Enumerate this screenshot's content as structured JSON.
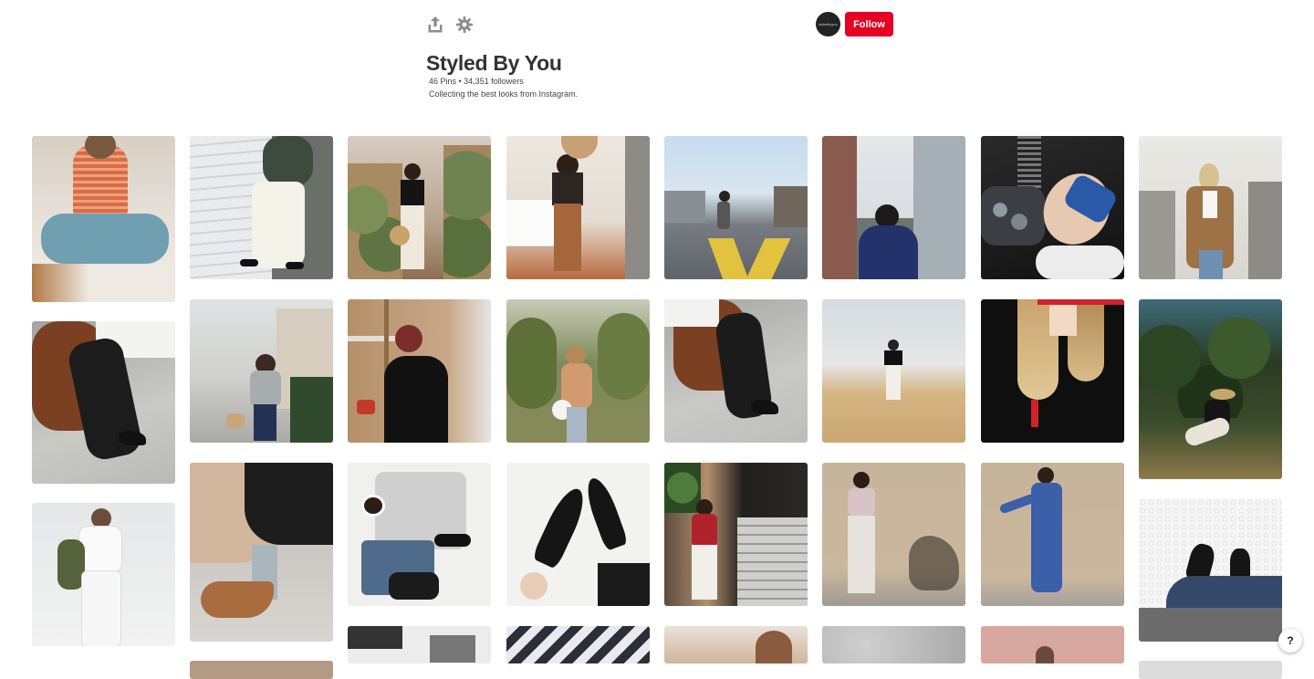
{
  "header": {
    "share_icon": "share-upload-icon",
    "settings_icon": "gear-icon",
    "avatar_text": "StyledByYou",
    "follow_label": "Follow",
    "accent_color": "#e60023"
  },
  "board": {
    "title": "Styled By You",
    "stats": "46 Pins • 34,351 followers",
    "description": "Collecting the best looks from Instagram."
  },
  "help": {
    "label": "?"
  },
  "pins": [
    {
      "col": 0,
      "scene": "woman in orange striped tee sitting on bed with mug"
    },
    {
      "col": 0,
      "scene": "legs in black pants and loafers on chair"
    },
    {
      "col": 0,
      "scene": "woman in white jeans holding jacket"
    },
    {
      "col": 1,
      "scene": "woman in white wide-leg pants on stairs"
    },
    {
      "col": 1,
      "scene": "person walking dog on sidewalk"
    },
    {
      "col": 1,
      "scene": "hand adjusting brown loafer"
    },
    {
      "col": 1,
      "scene": "partial bottom pin"
    },
    {
      "col": 2,
      "scene": "woman among potted cacti with straw hat"
    },
    {
      "col": 2,
      "scene": "woman with red hair in black sweater with tea"
    },
    {
      "col": 2,
      "scene": "flat lay of grey shirt, jeans and sneakers"
    },
    {
      "col": 2,
      "scene": "laptop flat lay"
    },
    {
      "col": 3,
      "scene": "woman in brown trousers in bedroom mirror"
    },
    {
      "col": 3,
      "scene": "woman in orchard with white bag"
    },
    {
      "col": 3,
      "scene": "pointed black flats on white rug"
    },
    {
      "col": 3,
      "scene": "striped stripes partial"
    },
    {
      "col": 4,
      "scene": "woman standing on street crosswalk"
    },
    {
      "col": 4,
      "scene": "legs in black pants and loafers"
    },
    {
      "col": 4,
      "scene": "woman in red top and white pants by steps"
    },
    {
      "col": 4,
      "scene": "man portrait partial"
    },
    {
      "col": 5,
      "scene": "woman between city buildings"
    },
    {
      "col": 5,
      "scene": "woman in golden field"
    },
    {
      "col": 5,
      "scene": "woman in grey pants on beige wall"
    },
    {
      "col": 5,
      "scene": "grey texture partial"
    },
    {
      "col": 6,
      "scene": "foot in blue sandal with sequin clutch"
    },
    {
      "col": 6,
      "scene": "woman in black sweater with necklace"
    },
    {
      "col": 6,
      "scene": "woman in blue denim jumpsuit"
    },
    {
      "col": 6,
      "scene": "pink wall partial"
    },
    {
      "col": 7,
      "scene": "woman in tan coat on balcony"
    },
    {
      "col": 7,
      "scene": "woman in hat sitting in orchard"
    },
    {
      "col": 7,
      "scene": "legs in jeans and loafers on tiles"
    }
  ]
}
